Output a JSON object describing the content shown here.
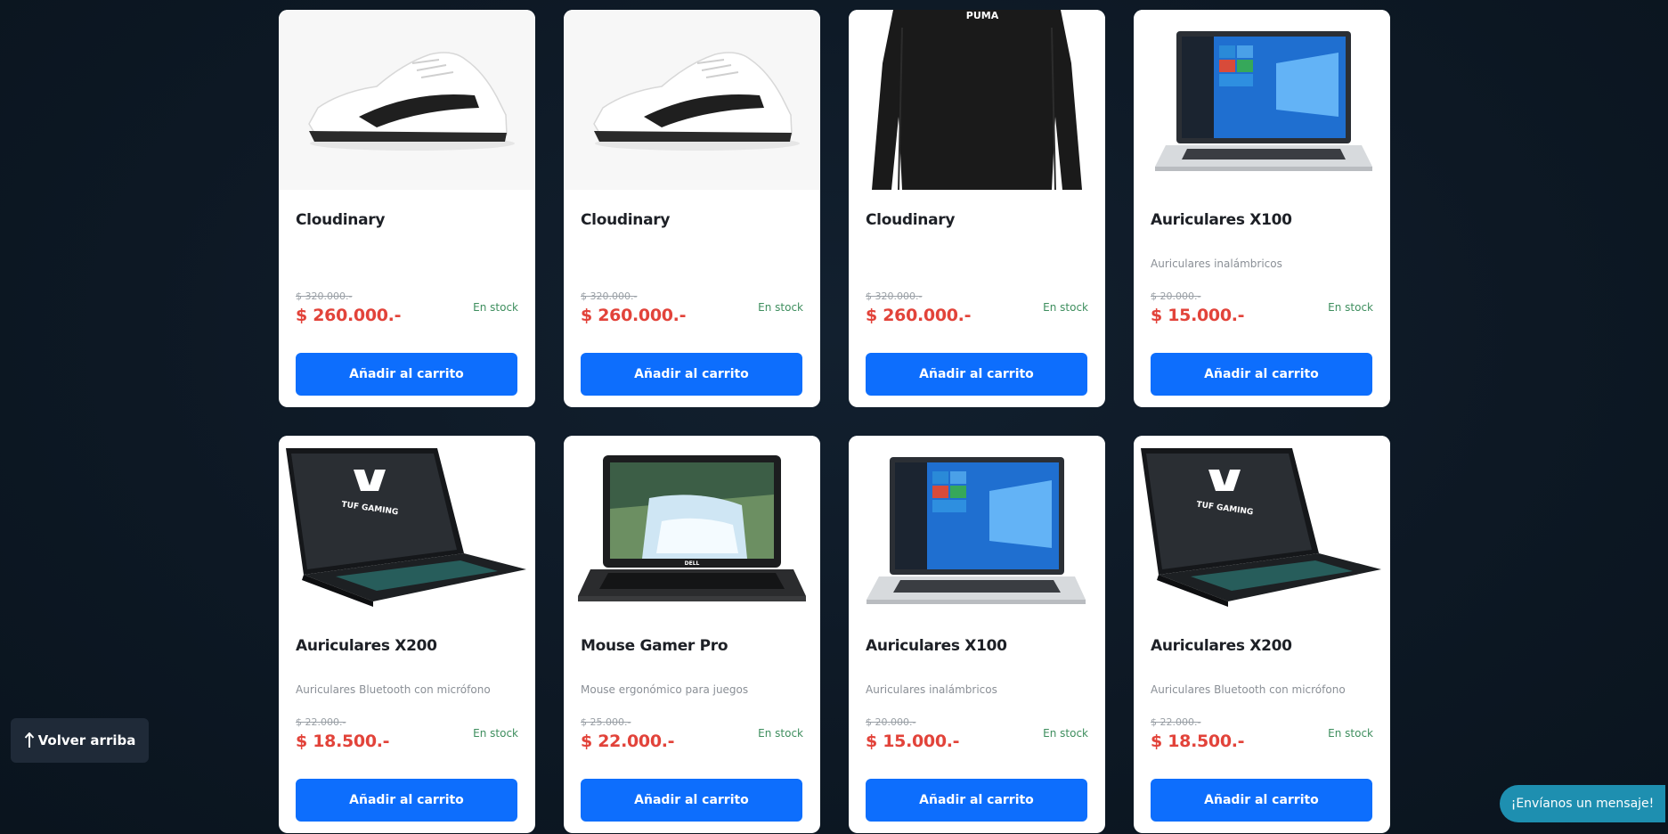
{
  "products": [
    {
      "title": "Cloudinary",
      "description": "",
      "old_price": "$ 320.000.-",
      "price": "$ 260.000.-",
      "stock": "En stock",
      "button": "Añadir al carrito",
      "image": "white-sneaker"
    },
    {
      "title": "Cloudinary",
      "description": "",
      "old_price": "$ 320.000.-",
      "price": "$ 260.000.-",
      "stock": "En stock",
      "button": "Añadir al carrito",
      "image": "white-sneaker"
    },
    {
      "title": "Cloudinary",
      "description": "",
      "old_price": "$ 320.000.-",
      "price": "$ 260.000.-",
      "stock": "En stock",
      "button": "Añadir al carrito",
      "image": "black-sweatshirt",
      "image_text": "PUMA"
    },
    {
      "title": "Auriculares X100",
      "description": "Auriculares inalámbricos",
      "old_price": "$ 20.000.-",
      "price": "$ 15.000.-",
      "stock": "En stock",
      "button": "Añadir al carrito",
      "image": "silver-laptop"
    },
    {
      "title": "Auriculares X200",
      "description": "Auriculares Bluetooth con micrófono",
      "old_price": "$ 22.000.-",
      "price": "$ 18.500.-",
      "stock": "En stock",
      "button": "Añadir al carrito",
      "image": "gaming-laptop",
      "image_text": "TUF GAMING"
    },
    {
      "title": "Mouse Gamer Pro",
      "description": "Mouse ergonómico para juegos",
      "old_price": "$ 25.000.-",
      "price": "$ 22.000.-",
      "stock": "En stock",
      "button": "Añadir al carrito",
      "image": "black-laptop",
      "image_text": "DELL"
    },
    {
      "title": "Auriculares X100",
      "description": "Auriculares inalámbricos",
      "old_price": "$ 20.000.-",
      "price": "$ 15.000.-",
      "stock": "En stock",
      "button": "Añadir al carrito",
      "image": "silver-laptop"
    },
    {
      "title": "Auriculares X200",
      "description": "Auriculares Bluetooth con micrófono",
      "old_price": "$ 22.000.-",
      "price": "$ 18.500.-",
      "stock": "En stock",
      "button": "Añadir al carrito",
      "image": "gaming-laptop",
      "image_text": "TUF GAMING"
    }
  ],
  "back_to_top": {
    "label": "Volver arriba",
    "icon": "arrow-up-icon"
  },
  "chat": {
    "label": "¡Envíanos un mensaje!"
  },
  "colors": {
    "accent": "#0d6efd",
    "price": "#e2433a",
    "stock": "#3e8e5e",
    "background": "#0d1824"
  }
}
